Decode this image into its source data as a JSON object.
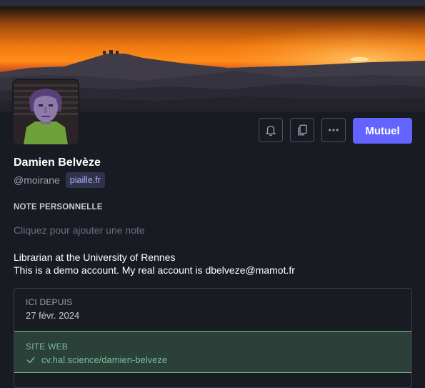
{
  "profile": {
    "display_name": "Damien Belvèze",
    "handle": "@moirane",
    "domain": "piaille.fr",
    "follow_label": "Mutuel"
  },
  "note": {
    "heading": "NOTE PERSONNELLE",
    "placeholder": "Cliquez pour ajouter une note"
  },
  "bio": {
    "line1": "Librarian at the University of Rennes",
    "line2": "This is a demo account. My real account is dbelveze@mamot.fr"
  },
  "fields": {
    "joined_label": "ICI DEPUIS",
    "joined_value": "27 févr. 2024",
    "website_label": "SITE WEB",
    "website_value": "cv.hal.science/damien-belveze"
  },
  "icons": [
    "bell-icon",
    "copy-icon",
    "more-icon",
    "check-icon"
  ],
  "colors": {
    "accent": "#6364ff",
    "background": "#191b22",
    "verified": "#79bd9a"
  }
}
